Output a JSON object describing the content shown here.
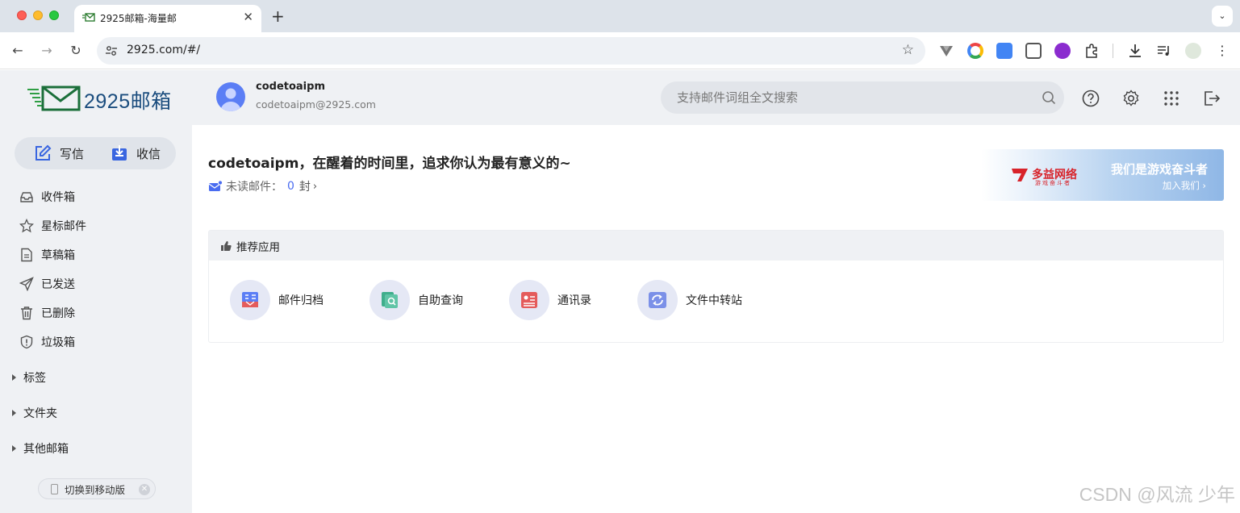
{
  "browser": {
    "tab_title": "2925邮箱-海量邮",
    "tab_close": "✕",
    "new_tab": "+",
    "tab_menu": "⌄",
    "url": "2925.com/#/",
    "nav": {
      "back": "←",
      "forward": "→",
      "reload": "↻"
    },
    "star": "☆"
  },
  "header": {
    "logo_text": "2925邮箱",
    "user_name": "codetoaipm",
    "user_email": "codetoaipm@2925.com",
    "search_placeholder": "支持邮件词组全文搜索"
  },
  "sidebar": {
    "compose_label": "写信",
    "receive_label": "收信",
    "folders": [
      {
        "label": "收件箱",
        "icon": "inbox-icon"
      },
      {
        "label": "星标邮件",
        "icon": "star-icon"
      },
      {
        "label": "草稿箱",
        "icon": "draft-icon"
      },
      {
        "label": "已发送",
        "icon": "send-icon"
      },
      {
        "label": "已删除",
        "icon": "trash-icon"
      },
      {
        "label": "垃圾箱",
        "icon": "shield-icon"
      }
    ],
    "groups": [
      {
        "label": "标签"
      },
      {
        "label": "文件夹"
      },
      {
        "label": "其他邮箱"
      }
    ],
    "mobile_switch": "切换到移动版",
    "mobile_close": "✕"
  },
  "main": {
    "greeting": "codetoaipm，在醒着的时间里，追求你认为最有意义的~",
    "unread_label": "未读邮件：",
    "unread_count": "0",
    "unread_unit": "封",
    "banner": {
      "brand": "多益网络",
      "sub": "游戏奋斗者",
      "slogan": "我们是游戏奋斗者",
      "link": "加入我们 ›"
    },
    "apps_title": "推荐应用",
    "apps": [
      {
        "label": "邮件归档",
        "icon": "archive-icon"
      },
      {
        "label": "自助查询",
        "icon": "query-icon"
      },
      {
        "label": "通讯录",
        "icon": "contacts-icon"
      },
      {
        "label": "文件中转站",
        "icon": "file-transfer-icon"
      }
    ]
  },
  "watermark": "CSDN @风流 少年",
  "colors": {
    "accent": "#4a6cf0",
    "sidebar_bg": "#eff1f4",
    "brand_red": "#d8232a"
  }
}
